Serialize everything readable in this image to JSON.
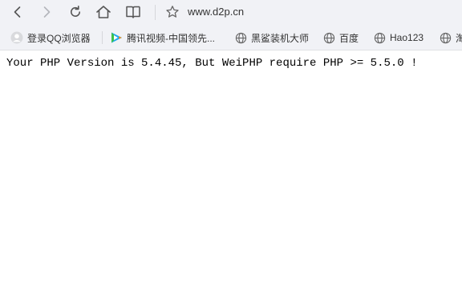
{
  "address_bar": {
    "url": "www.d2p.cn"
  },
  "bookmarks": [
    {
      "label": "登录QQ浏览器",
      "icon": "avatar-icon"
    },
    {
      "label": "腾讯视频-中国领先...",
      "icon": "tencent-video-icon"
    },
    {
      "label": "黑鲨装机大师",
      "icon": "globe-icon"
    },
    {
      "label": "百度",
      "icon": "globe-icon"
    },
    {
      "label": "Hao123",
      "icon": "globe-icon"
    },
    {
      "label": "淘",
      "icon": "globe-icon"
    }
  ],
  "page": {
    "message": "Your PHP Version is 5.4.45, But WeiPHP require PHP >= 5.5.0 !"
  },
  "colors": {
    "chrome_bg": "#f1f2f6",
    "icon_gray": "#555555",
    "tencent_video_blue": "#1ea8f4",
    "tencent_video_green": "#3ec24a",
    "tencent_video_orange": "#ff8a00"
  }
}
